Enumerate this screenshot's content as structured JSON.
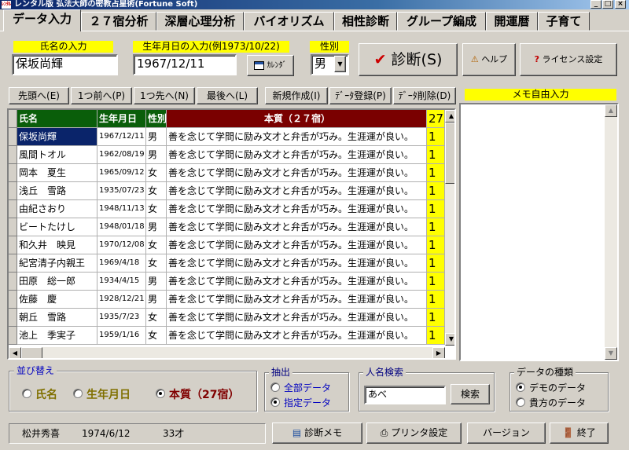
{
  "window": {
    "title": "レンタル版  弘法大師の密教占星術(Fortune Soft)",
    "icon_text": "ﾚﾝﾀﾙ"
  },
  "tabs": [
    "データ入力",
    "２７宿分析",
    "深層心理分析",
    "バイオリズム",
    "相性診断",
    "グループ編成",
    "開運暦",
    "子育て"
  ],
  "form": {
    "name_label": "氏名の入力",
    "name_value": "保坂尚輝",
    "birth_label": "生年月日の入力(例1973/10/22)",
    "birth_value": "1967/12/11",
    "calendar_label": "ｶﾚﾝﾀﾞ",
    "gender_label": "性別",
    "gender_value": "男",
    "diagnose_label": "診断(S)",
    "help_label": "ヘルプ",
    "license_label": "ライセンス設定"
  },
  "nav": {
    "first": "先頭へ(E)",
    "prev": "1つ前へ(P)",
    "next": "1つ先へ(N)",
    "last": "最後へ(L)",
    "new": "新規作成(I)",
    "register": "ﾃﾞｰﾀ登録(P)",
    "delete": "ﾃﾞｰﾀ削除(D)"
  },
  "memo": {
    "label": "メモ自由入力"
  },
  "grid": {
    "columns": [
      "氏名",
      "生年月日",
      "性別",
      "本質（２７宿）",
      "27"
    ],
    "rows": [
      {
        "name": "保坂尚輝",
        "birth": "1967/12/11",
        "gender": "男",
        "trait": "善を念じて学問に励み文才と弁舌が巧み。生涯運が良い。",
        "n": "1"
      },
      {
        "name": "風間トオル",
        "birth": "1962/08/19",
        "gender": "男",
        "trait": "善を念じて学問に励み文才と弁舌が巧み。生涯運が良い。",
        "n": "1"
      },
      {
        "name": "岡本　夏生",
        "birth": "1965/09/12",
        "gender": "女",
        "trait": "善を念じて学問に励み文才と弁舌が巧み。生涯運が良い。",
        "n": "1"
      },
      {
        "name": "浅丘　雪路",
        "birth": "1935/07/23",
        "gender": "女",
        "trait": "善を念じて学問に励み文才と弁舌が巧み。生涯運が良い。",
        "n": "1"
      },
      {
        "name": "由紀さおり",
        "birth": "1948/11/13",
        "gender": "女",
        "trait": "善を念じて学問に励み文才と弁舌が巧み。生涯運が良い。",
        "n": "1"
      },
      {
        "name": "ビートたけし",
        "birth": "1948/01/18",
        "gender": "男",
        "trait": "善を念じて学問に励み文才と弁舌が巧み。生涯運が良い。",
        "n": "1"
      },
      {
        "name": "和久井　映見",
        "birth": "1970/12/08",
        "gender": "女",
        "trait": "善を念じて学問に励み文才と弁舌が巧み。生涯運が良い。",
        "n": "1"
      },
      {
        "name": "紀宮清子内親王",
        "birth": "1969/4/18",
        "gender": "女",
        "trait": "善を念じて学問に励み文才と弁舌が巧み。生涯運が良い。",
        "n": "1"
      },
      {
        "name": "田原　総一郎",
        "birth": "1934/4/15",
        "gender": "男",
        "trait": "善を念じて学問に励み文才と弁舌が巧み。生涯運が良い。",
        "n": "1"
      },
      {
        "name": "佐藤　慶",
        "birth": "1928/12/21",
        "gender": "男",
        "trait": "善を念じて学問に励み文才と弁舌が巧み。生涯運が良い。",
        "n": "1"
      },
      {
        "name": "朝丘　雪路",
        "birth": "1935/7/23",
        "gender": "女",
        "trait": "善を念じて学問に励み文才と弁舌が巧み。生涯運が良い。",
        "n": "1"
      },
      {
        "name": "池上　季実子",
        "birth": "1959/1/16",
        "gender": "女",
        "trait": "善を念じて学問に励み文才と弁舌が巧み。生涯運が良い。",
        "n": "1"
      }
    ]
  },
  "sort": {
    "label": "並び替え",
    "options": [
      "氏名",
      "生年月日",
      "本質（27宿）"
    ],
    "selected": 2
  },
  "extract": {
    "label": "抽出",
    "options": [
      "全部データ",
      "指定データ"
    ],
    "selected": 1
  },
  "search": {
    "label": "人名検索",
    "value": "あべ",
    "button": "検索"
  },
  "datatype": {
    "label": "データの種類",
    "options": [
      "デモのデータ",
      "貴方のデータ"
    ],
    "selected": 0
  },
  "status": {
    "name": "松井秀喜",
    "birth": "1974/6/12",
    "age": "33才"
  },
  "bottom": {
    "memo": "診断メモ",
    "print": "プリンタ設定",
    "version": "バージョン",
    "exit": "終了"
  },
  "colors": {
    "title_bar": "#0a246a",
    "label_bg": "#ffff00",
    "header_name": "#0a5e0a",
    "header_trait": "#7a0000",
    "check": "#cc0000"
  }
}
